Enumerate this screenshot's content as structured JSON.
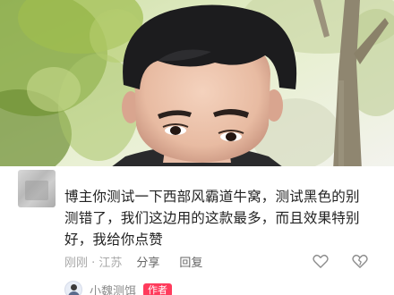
{
  "comment": {
    "text": "博主你测试一下西部风霸道牛窝，测试黑色的别测错了，我们这边用的这款最多，而且效果特别好，我给你点赞",
    "time_location": "刚刚 · 江苏",
    "share_label": "分享",
    "reply_label": "回复"
  },
  "author_reply": {
    "name": "小魏测饵",
    "badge": "作者"
  },
  "icons": {
    "like": "heart-outline-icon",
    "dislike": "broken-heart-outline-icon"
  },
  "colors": {
    "author_badge": "#ff3b5c",
    "comment_text": "#222222",
    "meta_text": "#999999"
  }
}
